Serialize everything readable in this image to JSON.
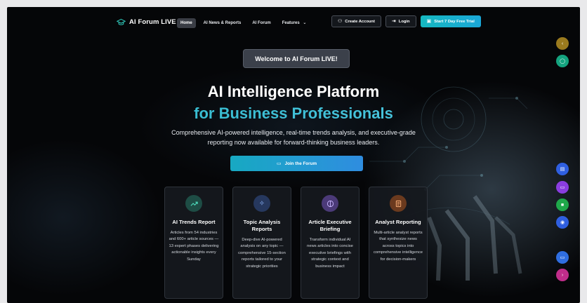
{
  "nav": {
    "brand": "AI Forum LIVE",
    "links": [
      "Home",
      "AI News & Reports",
      "AI Forum",
      "Features"
    ],
    "create_account": "Create Account",
    "login": "Login",
    "trial": "Start 7 Day Free Trial"
  },
  "hero": {
    "welcome": "Welcome to AI Forum LIVE!",
    "title_line1": "AI Intelligence Platform",
    "title_line2": "for Business Professionals",
    "subtitle": "Comprehensive AI-powered intelligence, real-time trends analysis, and executive-grade reporting now available for forward-thinking business leaders.",
    "join": "Join the Forum"
  },
  "cards": [
    {
      "title": "AI Trends Report",
      "desc": "Articles from 54 industries and 600+ article sources — 13 expert phases delivering actionable insights every Sunday",
      "icon": "trend-up-icon",
      "color": "#1e4d45"
    },
    {
      "title": "Topic Analysis Reports",
      "desc": "Deep-dive AI-powered analysis on any topic — comprehensive 15-section reports tailored to your strategic priorities",
      "icon": "sparkle-icon",
      "color": "#26385e"
    },
    {
      "title": "Article Executive Briefing",
      "desc": "Transform individual AI news articles into concise executive briefings with strategic context and business impact",
      "icon": "brain-icon",
      "color": "#4b3a78"
    },
    {
      "title": "Analyst Reporting",
      "desc": "Multi-article analyst reports that synthesize news across topics into comprehensive intelligence for decision-makers",
      "icon": "report-icon",
      "color": "#6b3a1e"
    }
  ],
  "colors": {
    "accent": "#2ec4b6",
    "background": "#050608"
  }
}
